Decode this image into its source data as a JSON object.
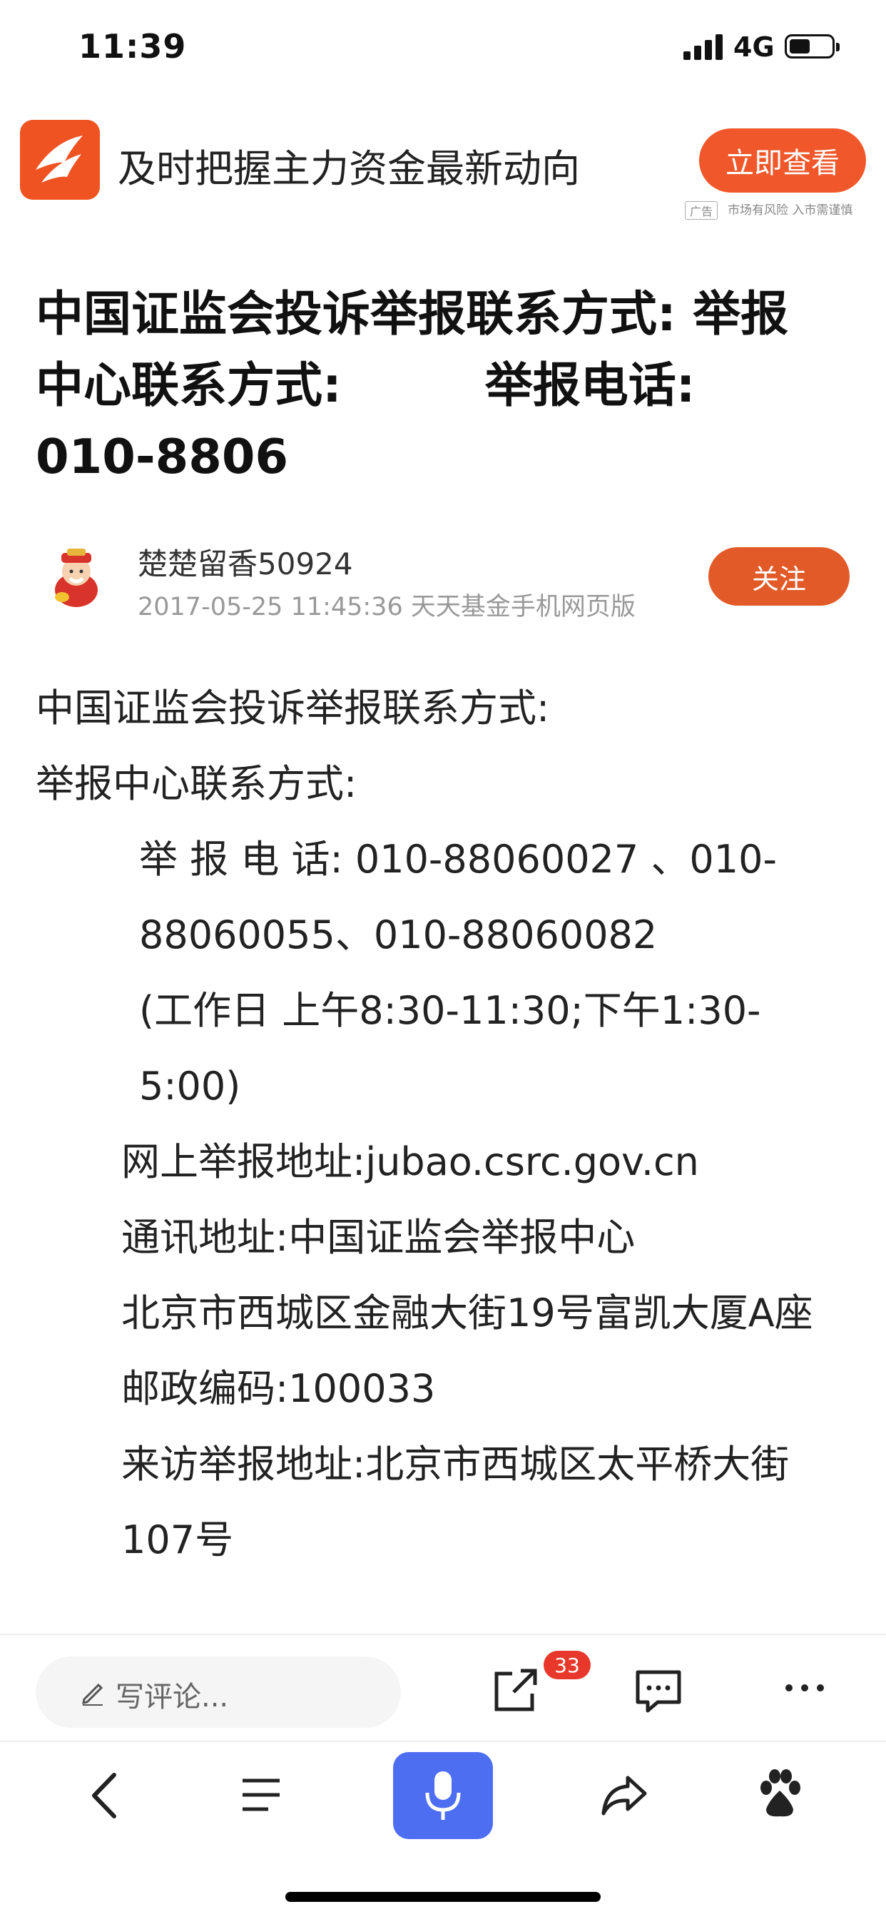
{
  "status_bar": {
    "time": "11:39",
    "network": "4G",
    "battery_level": 0.5
  },
  "ad": {
    "text": "及时把握主力资金最新动向",
    "button": "立即查看",
    "tag": "广告",
    "risk_note": "市场有风险 入市需谨慎",
    "logo_color": "#f05322"
  },
  "article": {
    "title_line1": "中国证监会投诉举报联系方式: 举报",
    "title_line2": "中心联系方式:　　　举报电话:",
    "title_line3": "010-8806",
    "author": "楚楚留香50924",
    "meta": "2017-05-25 11:45:36 天天基金手机网页版",
    "follow_button": "关注",
    "paragraphs": [
      "中国证监会投诉举报联系方式:",
      "举报中心联系方式:",
      "举 报 电 话: 010-88060027 、010-88060055、010-88060082",
      "(工作日 上午8:30-11:30;下午1:30-5:00)",
      "网上举报地址:jubao.csrc.gov.cn",
      "通讯地址:中国证监会举报中心",
      "北京市西城区金融大街19号富凯大厦A座",
      "邮政编码:100033",
      "来访举报地址:北京市西城区太平桥大街107号"
    ]
  },
  "comment_bar": {
    "placeholder": "写评论...",
    "share_count": "33",
    "icons": [
      "pencil-icon",
      "share-out-icon",
      "comment-icon",
      "more-icon"
    ]
  },
  "bottom_nav": {
    "icons": [
      "back-icon",
      "menu-icon",
      "microphone-icon",
      "forward-icon",
      "baidu-paw-icon"
    ],
    "accent": "#4e6ef2"
  }
}
